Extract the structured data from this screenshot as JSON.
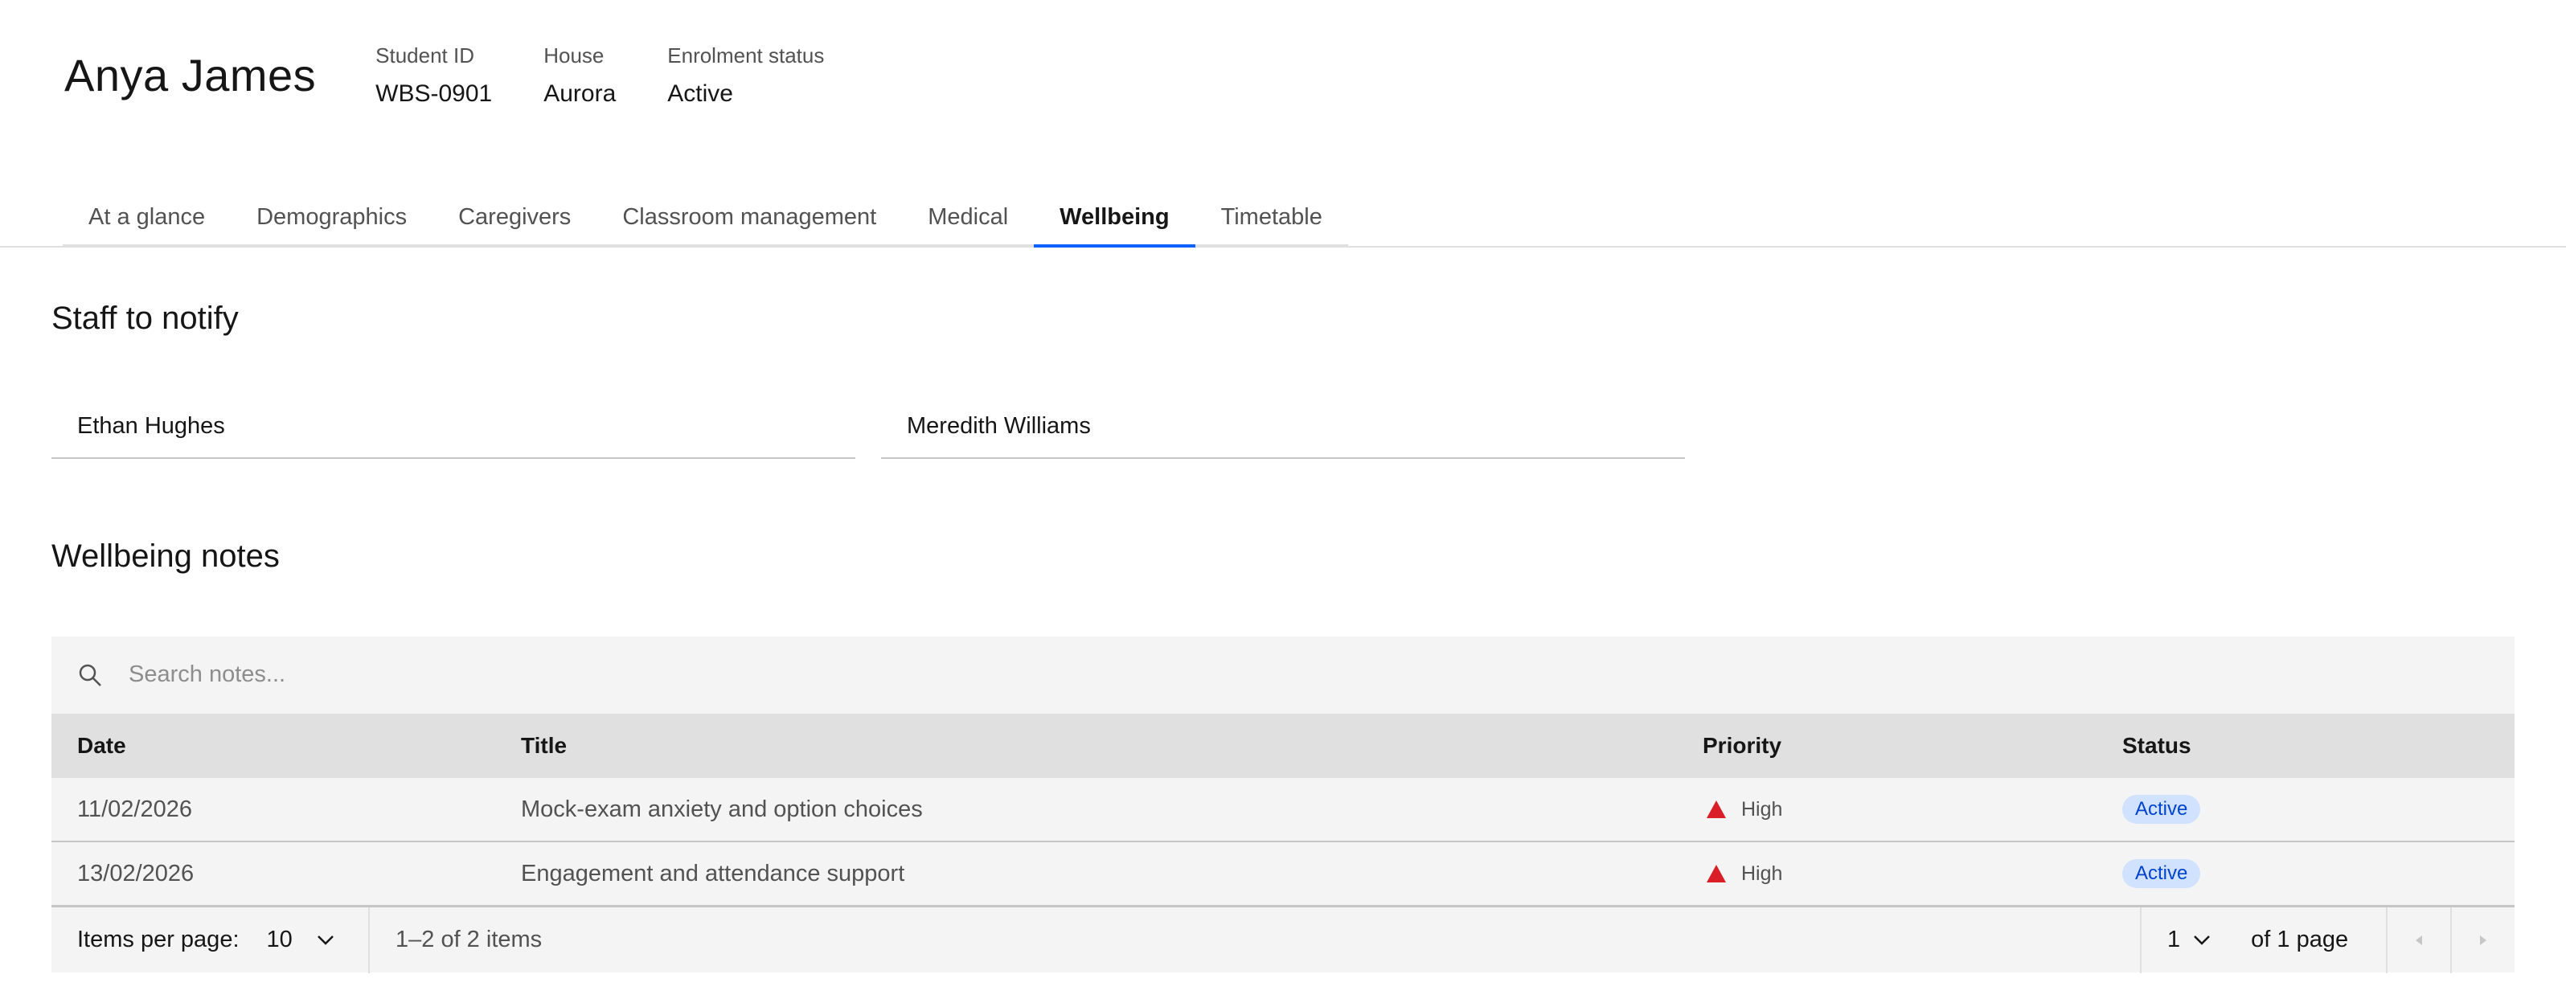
{
  "student": {
    "name": "Anya James",
    "meta": [
      {
        "label": "Student ID",
        "value": "WBS-0901"
      },
      {
        "label": "House",
        "value": "Aurora"
      },
      {
        "label": "Enrolment status",
        "value": "Active"
      }
    ]
  },
  "tabs": [
    {
      "label": "At a glance"
    },
    {
      "label": "Demographics"
    },
    {
      "label": "Caregivers"
    },
    {
      "label": "Classroom management"
    },
    {
      "label": "Medical"
    },
    {
      "label": "Wellbeing",
      "active": true
    },
    {
      "label": "Timetable"
    }
  ],
  "staff": {
    "title": "Staff to notify",
    "people": [
      "Ethan Hughes",
      "Meredith Williams"
    ]
  },
  "notes": {
    "title": "Wellbeing notes",
    "search_placeholder": "Search notes...",
    "columns": [
      "Date",
      "Title",
      "Priority",
      "Status"
    ],
    "rows": [
      {
        "date": "11/02/2026",
        "title": "Mock-exam anxiety and option choices",
        "priority": "High",
        "status": "Active"
      },
      {
        "date": "13/02/2026",
        "title": "Engagement and attendance support",
        "priority": "High",
        "status": "Active"
      }
    ]
  },
  "pagination": {
    "items_per_page_label": "Items per page:",
    "items_per_page_value": "10",
    "range_text": "1–2 of 2 items",
    "page_value": "1",
    "page_total_text": "of 1 page"
  },
  "icons": {
    "search": "search-icon",
    "priority_high": "warning-triangle-icon",
    "chevron": "chevron-down-icon",
    "prev": "caret-left-icon",
    "next": "caret-right-icon"
  },
  "colors": {
    "accent": "#0f62fe",
    "priority_high": "#da1e28",
    "tag_bg": "#d0e2ff",
    "tag_text": "#0043ce"
  }
}
